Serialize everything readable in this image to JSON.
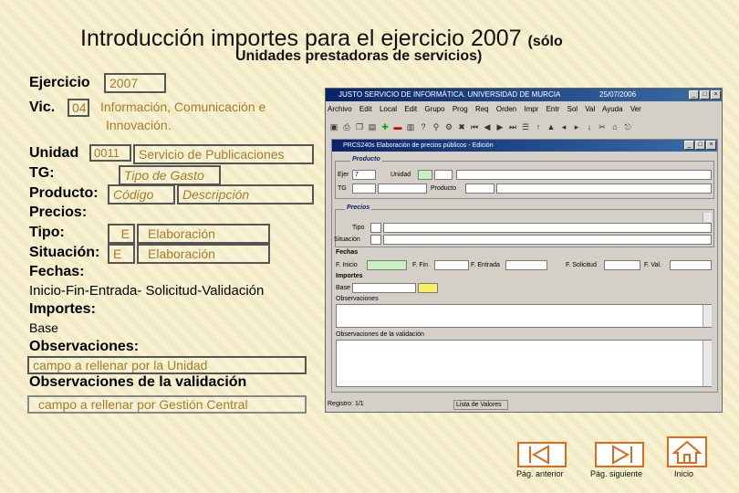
{
  "header": {
    "title": "Introducción importes para el ejercicio 2007",
    "title_suffix": "(sólo",
    "subtitle": "Unidades prestadoras de servicios)"
  },
  "form": {
    "ejercicio_label": "Ejercicio",
    "ejercicio_value": "2007",
    "vic_label": "Vic.",
    "vic_code": "04",
    "vic_desc_1": "Información, Comunicación e",
    "vic_desc_2": "Innovación.",
    "unidad_label": "Unidad",
    "unidad_code": "0011",
    "unidad_desc": "Servicio de Publicaciones",
    "tg_label": "TG:",
    "tg_value": "Tipo de Gasto",
    "producto_label": "Producto:",
    "producto_code": "Código",
    "producto_desc": "Descripción",
    "precios_label": "Precios:",
    "tipo_label": "Tipo:",
    "tipo_code": "E",
    "tipo_desc": "Elaboración",
    "situacion_label": "Situación:",
    "situacion_code": "E",
    "situacion_desc": "Elaboración",
    "fechas_label": "Fechas:",
    "fechas_desc": "Inicio-Fin-Entrada- Solicitud-Validación",
    "importes_label": "Importes:",
    "base_label": "Base",
    "observaciones_label": "Observaciones:",
    "observaciones_value": "campo a rellenar por la Unidad",
    "obs_validacion_label": "Observaciones de la validación",
    "obs_validacion_value": "campo a rellenar por Gestión Central"
  },
  "app": {
    "title": "JUSTO SERVICIO DE INFORMÁTICA. UNIVERSIDAD DE MURCIA",
    "date": "25/07/2006",
    "menu": [
      "Archivo",
      "Edit",
      "Local",
      "Edit",
      "Grupo",
      "Prog",
      "Req",
      "Orden",
      "Impr",
      "Entr",
      "Sol",
      "Val",
      "Ayuda",
      "Ver"
    ],
    "inner_title": "PRCS240s Elaboración de precios públicos - Edición",
    "group_producto": "Producto",
    "lbl_ejer": "Ejer",
    "ejer_value": "7",
    "lbl_unidad": "Unidad",
    "lbl_tg": "TG",
    "lbl_producto": "Producto",
    "group_precios": "Precios",
    "lbl_tipo": "Tipo",
    "lbl_situacion": "Situación",
    "lbl_fechas": "Fechas",
    "lbl_f_inicio": "F. Inicio",
    "lbl_f_fin": "F. Fin",
    "lbl_f_entrada": "F. Entrada",
    "lbl_f_solicitud": "F. Solicitud",
    "lbl_f_val": "F. Val.",
    "lbl_importes": "Importes",
    "lbl_base": "Base",
    "lbl_observaciones": "Observaciones",
    "lbl_obs_validacion": "Observaciones de la validación",
    "status_registro": "Registro: 1/1",
    "status_lista": "Lista de Valores"
  },
  "nav": {
    "prev": "Pág. anterior",
    "next": "Pág. siguiente",
    "home": "Inicio"
  },
  "colors": {
    "accent": "#e06a1c",
    "field_text": "#a67c2a",
    "background": "#f6efc8"
  }
}
